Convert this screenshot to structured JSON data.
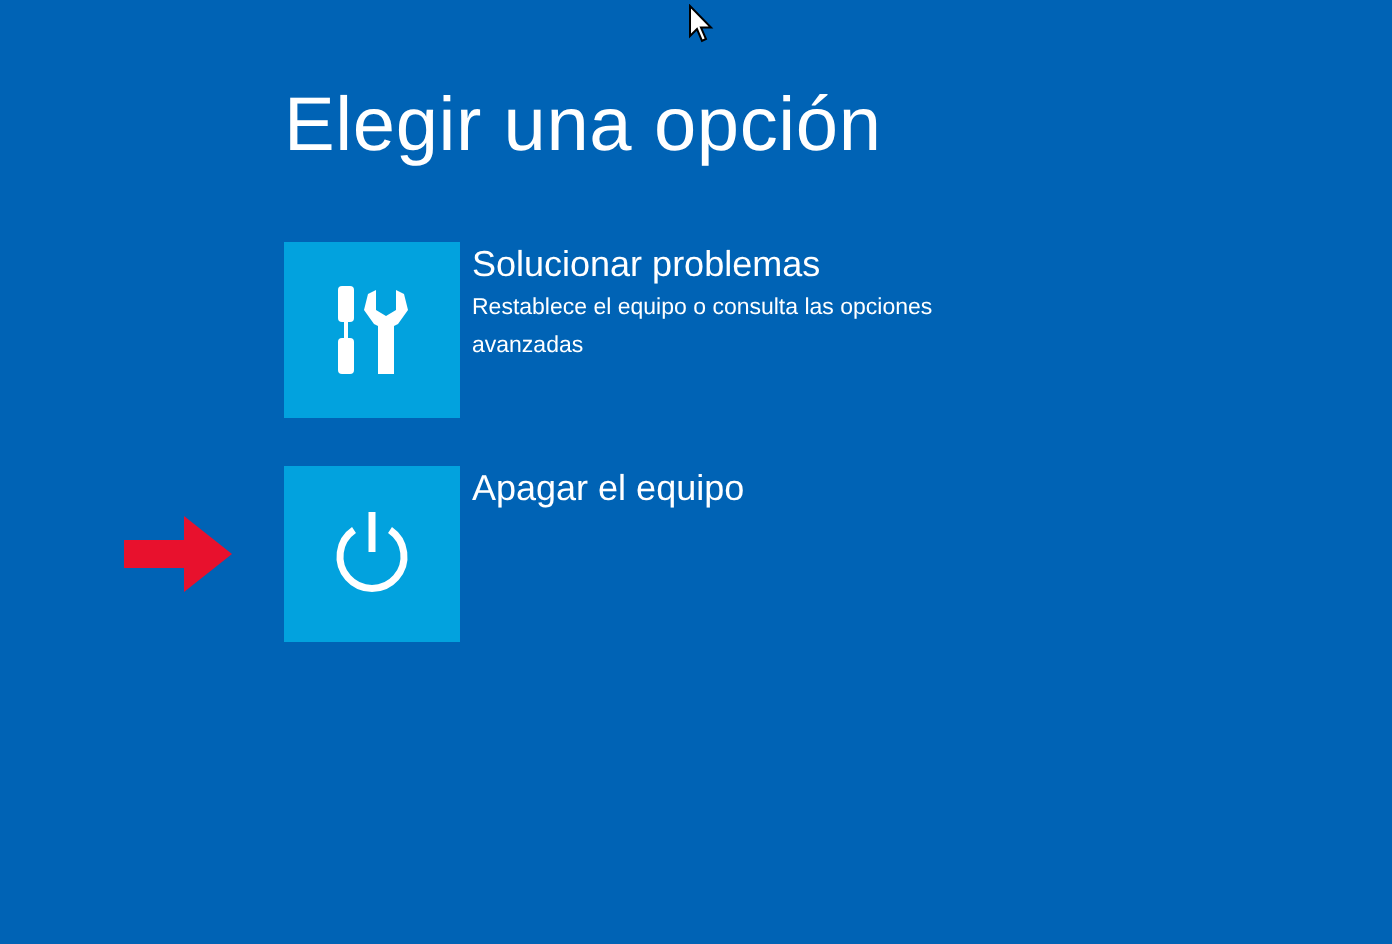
{
  "heading": "Elegir una opción",
  "options": [
    {
      "kind": "tools",
      "title": "Solucionar problemas",
      "description": "Restablece el equipo o consulta las opciones avanzadas"
    },
    {
      "kind": "power",
      "title": "Apagar el equipo"
    }
  ]
}
